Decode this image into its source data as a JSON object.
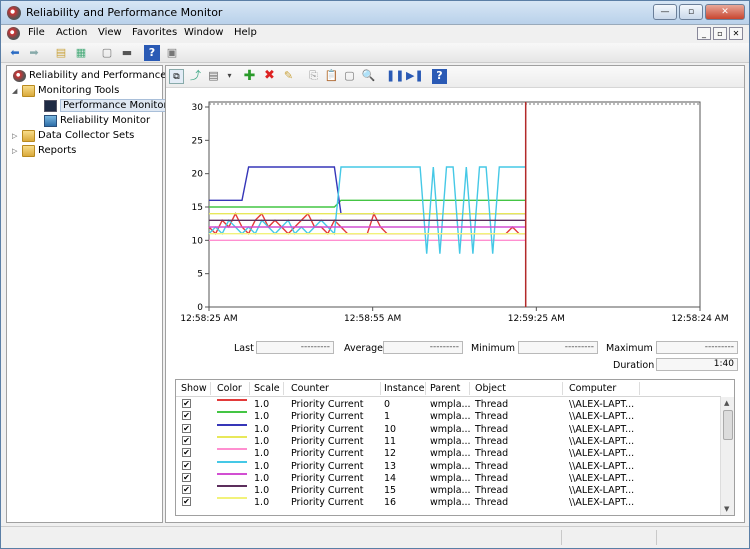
{
  "window": {
    "title": "Reliability and Performance Monitor"
  },
  "menu": [
    "File",
    "Action",
    "View",
    "Favorites",
    "Window",
    "Help"
  ],
  "tree": [
    {
      "label": "Reliability and Performance",
      "level": 0,
      "icon": "monitor-app-icon"
    },
    {
      "label": "Monitoring Tools",
      "level": 1,
      "icon": "folder-icon"
    },
    {
      "label": "Performance Monitor",
      "level": 2,
      "icon": "performance-monitor-icon",
      "selected": true
    },
    {
      "label": "Reliability Monitor",
      "level": 2,
      "icon": "reliability-monitor-icon"
    },
    {
      "label": "Data Collector Sets",
      "level": 1,
      "icon": "folder-icon"
    },
    {
      "label": "Reports",
      "level": 1,
      "icon": "folder-icon"
    }
  ],
  "chart_data": {
    "type": "line",
    "ylim": [
      0,
      30
    ],
    "yticks": [
      0,
      5,
      10,
      15,
      20,
      25,
      30
    ],
    "x_tick_labels": [
      "12:58:25 AM",
      "12:58:55 AM",
      "12:59:25 AM",
      "12:58:24 AM"
    ],
    "current_time_fraction": 0.645,
    "series": [
      {
        "name": "0",
        "color": "#e23a3a",
        "values": [
          12,
          11,
          13,
          12,
          14,
          12,
          11,
          13,
          14,
          12,
          13,
          12,
          11,
          12,
          13,
          14,
          12,
          12,
          11,
          13,
          12,
          11,
          11,
          11,
          11,
          14,
          12,
          11,
          11,
          11,
          11,
          11,
          11,
          11,
          11,
          11,
          11,
          11,
          11,
          11,
          11,
          11,
          11,
          11,
          11,
          11,
          12,
          11,
          11
        ]
      },
      {
        "name": "1",
        "color": "#44c544",
        "values": [
          15,
          15,
          15,
          15,
          15,
          15,
          15,
          15,
          15,
          15,
          15,
          15,
          15,
          15,
          15,
          15,
          15,
          15,
          15,
          15,
          16,
          16,
          16,
          16,
          16,
          16,
          16,
          16,
          16,
          16,
          16,
          16,
          16,
          16,
          16,
          16,
          16,
          16,
          16,
          16,
          16,
          16,
          16,
          16,
          16,
          16,
          16,
          16,
          16
        ]
      },
      {
        "name": "10",
        "color": "#3636b8",
        "values": [
          16,
          16,
          16,
          16,
          16,
          16,
          21,
          21,
          21,
          21,
          21,
          21,
          21,
          21,
          21,
          21,
          21,
          21,
          21,
          21,
          14,
          14,
          14,
          14,
          14,
          14,
          14,
          14,
          14,
          14,
          14,
          14,
          14,
          14,
          14,
          14,
          14,
          14,
          14,
          14,
          14,
          14,
          14,
          14,
          14,
          14,
          14,
          14,
          14
        ]
      },
      {
        "name": "11",
        "color": "#e8e85a",
        "values": [
          14,
          14,
          14,
          14,
          14,
          14,
          14,
          14,
          14,
          14,
          14,
          14,
          14,
          14,
          14,
          14,
          14,
          14,
          14,
          14,
          14,
          14,
          14,
          14,
          14,
          14,
          14,
          14,
          14,
          14,
          14,
          14,
          14,
          14,
          14,
          14,
          14,
          14,
          14,
          14,
          14,
          14,
          14,
          14,
          14,
          14,
          14,
          14,
          14
        ]
      },
      {
        "name": "12",
        "color": "#ff8fd0",
        "values": [
          10,
          10,
          10,
          10,
          10,
          10,
          10,
          10,
          10,
          10,
          10,
          10,
          10,
          10,
          10,
          10,
          10,
          10,
          10,
          10,
          10,
          10,
          10,
          10,
          10,
          10,
          10,
          10,
          10,
          10,
          10,
          10,
          10,
          10,
          10,
          10,
          10,
          10,
          10,
          10,
          10,
          10,
          10,
          10,
          10,
          10,
          10,
          10,
          10
        ]
      },
      {
        "name": "13",
        "color": "#45c8e6",
        "values": [
          11,
          12,
          11,
          13,
          12,
          11,
          12,
          11,
          13,
          12,
          11,
          12,
          13,
          11,
          12,
          11,
          12,
          13,
          12,
          11,
          21,
          21,
          21,
          21,
          21,
          21,
          21,
          21,
          21,
          21,
          21,
          21,
          21,
          8,
          21,
          8,
          21,
          21,
          8,
          21,
          8,
          21,
          21,
          8,
          21,
          21,
          21,
          21,
          21
        ]
      },
      {
        "name": "14",
        "color": "#d24fd2",
        "values": [
          12,
          12,
          12,
          12,
          12,
          12,
          12,
          12,
          12,
          12,
          12,
          12,
          12,
          12,
          12,
          12,
          12,
          12,
          12,
          12,
          12,
          12,
          12,
          12,
          12,
          12,
          12,
          12,
          12,
          12,
          12,
          12,
          12,
          12,
          12,
          12,
          12,
          12,
          12,
          12,
          12,
          12,
          12,
          12,
          12,
          12,
          12,
          12,
          12
        ]
      },
      {
        "name": "15",
        "color": "#5c2e5c",
        "values": [
          13,
          13,
          13,
          13,
          13,
          13,
          13,
          13,
          13,
          13,
          13,
          13,
          13,
          13,
          13,
          13,
          13,
          13,
          13,
          13,
          13,
          13,
          13,
          13,
          13,
          13,
          13,
          13,
          13,
          13,
          13,
          13,
          13,
          13,
          13,
          13,
          13,
          13,
          13,
          13,
          13,
          13,
          13,
          13,
          13,
          13,
          13,
          13,
          13
        ]
      },
      {
        "name": "16",
        "color": "#f2f27a",
        "values": [
          11,
          11,
          11,
          11,
          11,
          11,
          11,
          11,
          11,
          11,
          11,
          11,
          11,
          11,
          11,
          11,
          11,
          11,
          11,
          11,
          11,
          11,
          11,
          11,
          11,
          11,
          11,
          11,
          11,
          11,
          11,
          11,
          11,
          11,
          11,
          11,
          11,
          11,
          11,
          11,
          11,
          11,
          11,
          11,
          11,
          11,
          11,
          11,
          11
        ]
      }
    ]
  },
  "stats": {
    "last_label": "Last",
    "last_value": "---------",
    "average_label": "Average",
    "average_value": "---------",
    "minimum_label": "Minimum",
    "minimum_value": "---------",
    "maximum_label": "Maximum",
    "maximum_value": "---------",
    "duration_label": "Duration",
    "duration_value": "1:40"
  },
  "legend": {
    "headers": [
      "Show",
      "Color",
      "Scale",
      "Counter",
      "Instance",
      "Parent",
      "Object",
      "Computer"
    ],
    "rows": [
      {
        "check": "✔",
        "color": "#e23a3a",
        "scale": "1.0",
        "counter": "Priority Current",
        "instance": "0",
        "parent": "wmpla...",
        "object": "Thread",
        "computer": "\\\\ALEX-LAPT..."
      },
      {
        "check": "✔",
        "color": "#44c544",
        "scale": "1.0",
        "counter": "Priority Current",
        "instance": "1",
        "parent": "wmpla...",
        "object": "Thread",
        "computer": "\\\\ALEX-LAPT..."
      },
      {
        "check": "✔",
        "color": "#3636b8",
        "scale": "1.0",
        "counter": "Priority Current",
        "instance": "10",
        "parent": "wmpla...",
        "object": "Thread",
        "computer": "\\\\ALEX-LAPT..."
      },
      {
        "check": "✔",
        "color": "#e8e85a",
        "scale": "1.0",
        "counter": "Priority Current",
        "instance": "11",
        "parent": "wmpla...",
        "object": "Thread",
        "computer": "\\\\ALEX-LAPT..."
      },
      {
        "check": "✔",
        "color": "#ff8fd0",
        "scale": "1.0",
        "counter": "Priority Current",
        "instance": "12",
        "parent": "wmpla...",
        "object": "Thread",
        "computer": "\\\\ALEX-LAPT..."
      },
      {
        "check": "✔",
        "color": "#45c8e6",
        "scale": "1.0",
        "counter": "Priority Current",
        "instance": "13",
        "parent": "wmpla...",
        "object": "Thread",
        "computer": "\\\\ALEX-LAPT..."
      },
      {
        "check": "✔",
        "color": "#d24fd2",
        "scale": "1.0",
        "counter": "Priority Current",
        "instance": "14",
        "parent": "wmpla...",
        "object": "Thread",
        "computer": "\\\\ALEX-LAPT..."
      },
      {
        "check": "✔",
        "color": "#5c2e5c",
        "scale": "1.0",
        "counter": "Priority Current",
        "instance": "15",
        "parent": "wmpla...",
        "object": "Thread",
        "computer": "\\\\ALEX-LAPT..."
      },
      {
        "check": "✔",
        "color": "#f2f27a",
        "scale": "1.0",
        "counter": "Priority Current",
        "instance": "16",
        "parent": "wmpla...",
        "object": "Thread",
        "computer": "\\\\ALEX-LAPT..."
      }
    ]
  }
}
